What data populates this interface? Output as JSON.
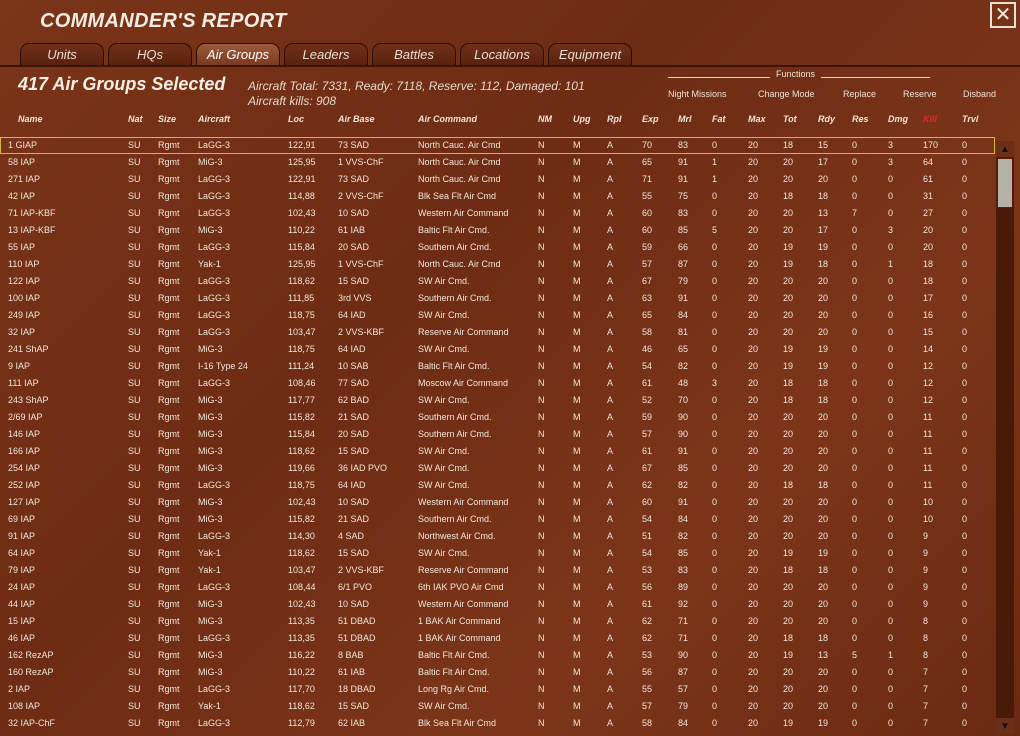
{
  "window": {
    "title": "COMMANDER'S REPORT",
    "close_glyph": "✕"
  },
  "tabs": [
    "Units",
    "HQs",
    "Air Groups",
    "Leaders",
    "Battles",
    "Locations",
    "Equipment"
  ],
  "active_tab": "Air Groups",
  "summary": {
    "selected": "417 Air Groups Selected",
    "line1": "Aircraft Total: 7331, Ready: 7118, Reserve: 112, Damaged: 101",
    "line2": "Aircraft kills: 908"
  },
  "functions": {
    "label": "Functions",
    "buttons": [
      "Night Missions",
      "Change Mode",
      "Replace",
      "Reserve",
      "Disband"
    ]
  },
  "columns": [
    "Name",
    "Nat",
    "Size",
    "Aircraft",
    "Loc",
    "Air Base",
    "Air Command",
    "NM",
    "Upg",
    "Rpl",
    "Exp",
    "Mrl",
    "Fat",
    "Max",
    "Tot",
    "Rdy",
    "Res",
    "Dmg",
    "Kill",
    "Trvl"
  ],
  "highlight_column_color": "#e2282a",
  "rows": [
    [
      "1 GIAP",
      "SU",
      "Rgmt",
      "LaGG-3",
      "122,91",
      "73 SAD",
      "North Cauc. Air Cmd",
      "N",
      "M",
      "A",
      "70",
      "83",
      "0",
      "20",
      "18",
      "15",
      "0",
      "3",
      "170",
      "0"
    ],
    [
      "58 IAP",
      "SU",
      "Rgmt",
      "MiG-3",
      "125,95",
      "1 VVS-ChF",
      "North Cauc. Air Cmd",
      "N",
      "M",
      "A",
      "65",
      "91",
      "1",
      "20",
      "20",
      "17",
      "0",
      "3",
      "64",
      "0"
    ],
    [
      "271 IAP",
      "SU",
      "Rgmt",
      "LaGG-3",
      "122,91",
      "73 SAD",
      "North Cauc. Air Cmd",
      "N",
      "M",
      "A",
      "71",
      "91",
      "1",
      "20",
      "20",
      "20",
      "0",
      "0",
      "61",
      "0"
    ],
    [
      "42 IAP",
      "SU",
      "Rgmt",
      "LaGG-3",
      "114,88",
      "2 VVS-ChF",
      "Blk Sea Flt Air Cmd",
      "N",
      "M",
      "A",
      "55",
      "75",
      "0",
      "20",
      "18",
      "18",
      "0",
      "0",
      "31",
      "0"
    ],
    [
      "71 IAP-KBF",
      "SU",
      "Rgmt",
      "LaGG-3",
      "102,43",
      "10 SAD",
      "Western Air Command",
      "N",
      "M",
      "A",
      "60",
      "83",
      "0",
      "20",
      "20",
      "13",
      "7",
      "0",
      "27",
      "0"
    ],
    [
      "13 IAP-KBF",
      "SU",
      "Rgmt",
      "MiG-3",
      "110,22",
      "61 IAB",
      "Baltic Flt Air Cmd.",
      "N",
      "M",
      "A",
      "60",
      "85",
      "5",
      "20",
      "20",
      "17",
      "0",
      "3",
      "20",
      "0"
    ],
    [
      "55 IAP",
      "SU",
      "Rgmt",
      "LaGG-3",
      "115,84",
      "20 SAD",
      "Southern Air Cmd.",
      "N",
      "M",
      "A",
      "59",
      "66",
      "0",
      "20",
      "19",
      "19",
      "0",
      "0",
      "20",
      "0"
    ],
    [
      "110 IAP",
      "SU",
      "Rgmt",
      "Yak-1",
      "125,95",
      "1 VVS-ChF",
      "North Cauc. Air Cmd",
      "N",
      "M",
      "A",
      "57",
      "87",
      "0",
      "20",
      "19",
      "18",
      "0",
      "1",
      "18",
      "0"
    ],
    [
      "122 IAP",
      "SU",
      "Rgmt",
      "LaGG-3",
      "118,62",
      "15 SAD",
      "SW Air Cmd.",
      "N",
      "M",
      "A",
      "67",
      "79",
      "0",
      "20",
      "20",
      "20",
      "0",
      "0",
      "18",
      "0"
    ],
    [
      "100 IAP",
      "SU",
      "Rgmt",
      "LaGG-3",
      "111,85",
      "3rd VVS",
      "Southern Air Cmd.",
      "N",
      "M",
      "A",
      "63",
      "91",
      "0",
      "20",
      "20",
      "20",
      "0",
      "0",
      "17",
      "0"
    ],
    [
      "249 IAP",
      "SU",
      "Rgmt",
      "LaGG-3",
      "118,75",
      "64 IAD",
      "SW Air Cmd.",
      "N",
      "M",
      "A",
      "65",
      "84",
      "0",
      "20",
      "20",
      "20",
      "0",
      "0",
      "16",
      "0"
    ],
    [
      "32 IAP",
      "SU",
      "Rgmt",
      "LaGG-3",
      "103,47",
      "2 VVS-KBF",
      "Reserve Air Command",
      "N",
      "M",
      "A",
      "58",
      "81",
      "0",
      "20",
      "20",
      "20",
      "0",
      "0",
      "15",
      "0"
    ],
    [
      "241 ShAP",
      "SU",
      "Rgmt",
      "MiG-3",
      "118,75",
      "64 IAD",
      "SW Air Cmd.",
      "N",
      "M",
      "A",
      "46",
      "65",
      "0",
      "20",
      "19",
      "19",
      "0",
      "0",
      "14",
      "0"
    ],
    [
      "9 IAP",
      "SU",
      "Rgmt",
      "I-16 Type 24",
      "111,24",
      "10 SAB",
      "Baltic Flt Air Cmd.",
      "N",
      "M",
      "A",
      "54",
      "82",
      "0",
      "20",
      "19",
      "19",
      "0",
      "0",
      "12",
      "0"
    ],
    [
      "111 IAP",
      "SU",
      "Rgmt",
      "LaGG-3",
      "108,46",
      "77 SAD",
      "Moscow Air Command",
      "N",
      "M",
      "A",
      "61",
      "48",
      "3",
      "20",
      "18",
      "18",
      "0",
      "0",
      "12",
      "0"
    ],
    [
      "243 ShAP",
      "SU",
      "Rgmt",
      "MiG-3",
      "117,77",
      "62 BAD",
      "SW Air Cmd.",
      "N",
      "M",
      "A",
      "52",
      "70",
      "0",
      "20",
      "18",
      "18",
      "0",
      "0",
      "12",
      "0"
    ],
    [
      "2/69 IAP",
      "SU",
      "Rgmt",
      "MiG-3",
      "115,82",
      "21 SAD",
      "Southern Air Cmd.",
      "N",
      "M",
      "A",
      "59",
      "90",
      "0",
      "20",
      "20",
      "20",
      "0",
      "0",
      "11",
      "0"
    ],
    [
      "146 IAP",
      "SU",
      "Rgmt",
      "MiG-3",
      "115,84",
      "20 SAD",
      "Southern Air Cmd.",
      "N",
      "M",
      "A",
      "57",
      "90",
      "0",
      "20",
      "20",
      "20",
      "0",
      "0",
      "11",
      "0"
    ],
    [
      "166 IAP",
      "SU",
      "Rgmt",
      "MiG-3",
      "118,62",
      "15 SAD",
      "SW Air Cmd.",
      "N",
      "M",
      "A",
      "61",
      "91",
      "0",
      "20",
      "20",
      "20",
      "0",
      "0",
      "11",
      "0"
    ],
    [
      "254 IAP",
      "SU",
      "Rgmt",
      "MiG-3",
      "119,66",
      "36 IAD PVO",
      "SW Air Cmd.",
      "N",
      "M",
      "A",
      "67",
      "85",
      "0",
      "20",
      "20",
      "20",
      "0",
      "0",
      "11",
      "0"
    ],
    [
      "252 IAP",
      "SU",
      "Rgmt",
      "LaGG-3",
      "118,75",
      "64 IAD",
      "SW Air Cmd.",
      "N",
      "M",
      "A",
      "62",
      "82",
      "0",
      "20",
      "18",
      "18",
      "0",
      "0",
      "11",
      "0"
    ],
    [
      "127 IAP",
      "SU",
      "Rgmt",
      "MiG-3",
      "102,43",
      "10 SAD",
      "Western Air Command",
      "N",
      "M",
      "A",
      "60",
      "91",
      "0",
      "20",
      "20",
      "20",
      "0",
      "0",
      "10",
      "0"
    ],
    [
      "69 IAP",
      "SU",
      "Rgmt",
      "MiG-3",
      "115,82",
      "21 SAD",
      "Southern Air Cmd.",
      "N",
      "M",
      "A",
      "54",
      "84",
      "0",
      "20",
      "20",
      "20",
      "0",
      "0",
      "10",
      "0"
    ],
    [
      "91 IAP",
      "SU",
      "Rgmt",
      "LaGG-3",
      "114,30",
      "4 SAD",
      "Northwest Air Cmd.",
      "N",
      "M",
      "A",
      "51",
      "82",
      "0",
      "20",
      "20",
      "20",
      "0",
      "0",
      "9",
      "0"
    ],
    [
      "64 IAP",
      "SU",
      "Rgmt",
      "Yak-1",
      "118,62",
      "15 SAD",
      "SW Air Cmd.",
      "N",
      "M",
      "A",
      "54",
      "85",
      "0",
      "20",
      "19",
      "19",
      "0",
      "0",
      "9",
      "0"
    ],
    [
      "79 IAP",
      "SU",
      "Rgmt",
      "Yak-1",
      "103,47",
      "2 VVS-KBF",
      "Reserve Air Command",
      "N",
      "M",
      "A",
      "53",
      "83",
      "0",
      "20",
      "18",
      "18",
      "0",
      "0",
      "9",
      "0"
    ],
    [
      "24 IAP",
      "SU",
      "Rgmt",
      "LaGG-3",
      "108,44",
      "6/1 PVO",
      "6th IAK PVO Air Cmd",
      "N",
      "M",
      "A",
      "56",
      "89",
      "0",
      "20",
      "20",
      "20",
      "0",
      "0",
      "9",
      "0"
    ],
    [
      "44 IAP",
      "SU",
      "Rgmt",
      "MiG-3",
      "102,43",
      "10 SAD",
      "Western Air Command",
      "N",
      "M",
      "A",
      "61",
      "92",
      "0",
      "20",
      "20",
      "20",
      "0",
      "0",
      "9",
      "0"
    ],
    [
      "15 IAP",
      "SU",
      "Rgmt",
      "MiG-3",
      "113,35",
      "51 DBAD",
      "1 BAK Air Command",
      "N",
      "M",
      "A",
      "62",
      "71",
      "0",
      "20",
      "20",
      "20",
      "0",
      "0",
      "8",
      "0"
    ],
    [
      "46 IAP",
      "SU",
      "Rgmt",
      "LaGG-3",
      "113,35",
      "51 DBAD",
      "1 BAK Air Command",
      "N",
      "M",
      "A",
      "62",
      "71",
      "0",
      "20",
      "18",
      "18",
      "0",
      "0",
      "8",
      "0"
    ],
    [
      "162 RezAP",
      "SU",
      "Rgmt",
      "MiG-3",
      "116,22",
      "8 BAB",
      "Baltic Flt Air Cmd.",
      "N",
      "M",
      "A",
      "53",
      "90",
      "0",
      "20",
      "19",
      "13",
      "5",
      "1",
      "8",
      "0"
    ],
    [
      "160 RezAP",
      "SU",
      "Rgmt",
      "MiG-3",
      "110,22",
      "61 IAB",
      "Baltic Flt Air Cmd.",
      "N",
      "M",
      "A",
      "56",
      "87",
      "0",
      "20",
      "20",
      "20",
      "0",
      "0",
      "7",
      "0"
    ],
    [
      "2 IAP",
      "SU",
      "Rgmt",
      "LaGG-3",
      "117,70",
      "18 DBAD",
      "Long Rg Air Cmd.",
      "N",
      "M",
      "A",
      "55",
      "57",
      "0",
      "20",
      "20",
      "20",
      "0",
      "0",
      "7",
      "0"
    ],
    [
      "108 IAP",
      "SU",
      "Rgmt",
      "Yak-1",
      "118,62",
      "15 SAD",
      "SW Air Cmd.",
      "N",
      "M",
      "A",
      "57",
      "79",
      "0",
      "20",
      "20",
      "20",
      "0",
      "0",
      "7",
      "0"
    ],
    [
      "32 IAP-ChF",
      "SU",
      "Rgmt",
      "LaGG-3",
      "112,79",
      "62 IAB",
      "Blk Sea Flt Air Cmd",
      "N",
      "M",
      "A",
      "58",
      "84",
      "0",
      "20",
      "19",
      "19",
      "0",
      "0",
      "7",
      "0"
    ]
  ],
  "scrollbar": {
    "up_glyph": "▲",
    "down_glyph": "▼"
  }
}
